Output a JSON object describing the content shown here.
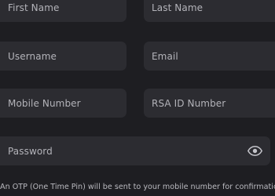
{
  "form": {
    "first_name_placeholder": "First Name",
    "last_name_placeholder": "Last Name",
    "username_placeholder": "Username",
    "email_placeholder": "Email",
    "mobile_placeholder": "Mobile Number",
    "rsa_id_placeholder": "RSA ID Number",
    "password_placeholder": "Password",
    "password_toggle_icon": "eye-icon",
    "otp_notice": "An OTP (One Time Pin) will be sent to your mobile number for confirmation"
  },
  "colors": {
    "background": "#1e1e22",
    "field_background": "#2c2c31",
    "placeholder_text": "#b3b3b9"
  }
}
